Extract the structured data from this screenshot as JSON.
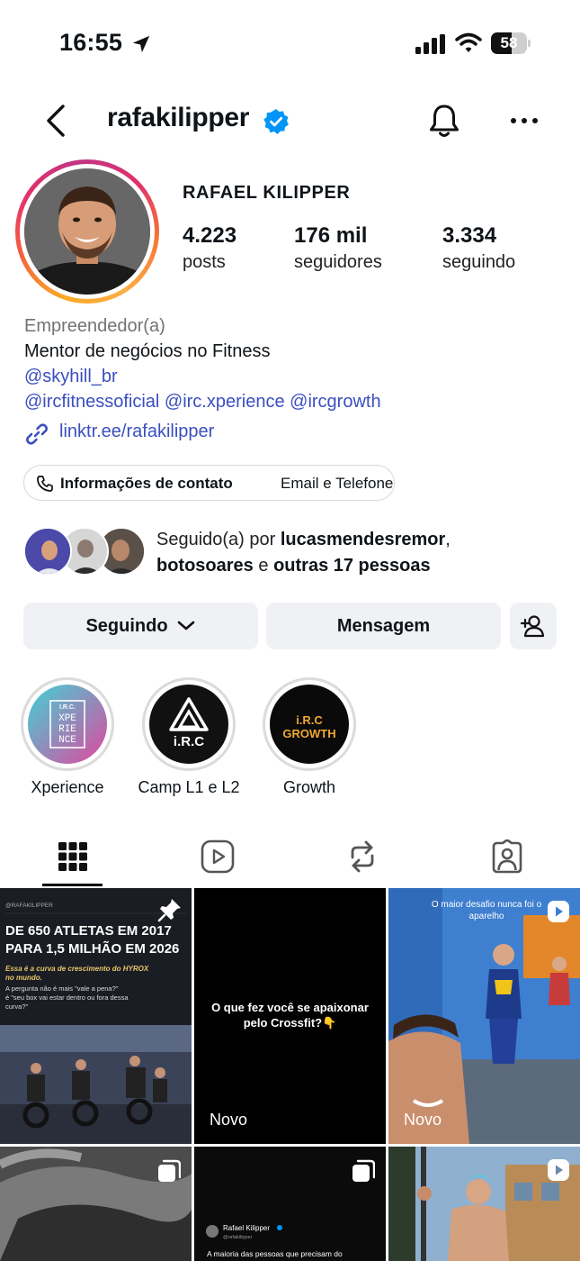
{
  "status_bar": {
    "time": "16:55",
    "battery": "58",
    "battery_level": 0.58
  },
  "header": {
    "username": "rafakilipper"
  },
  "profile": {
    "full_name": "RAFAEL KILIPPER",
    "stats": [
      {
        "value": "4.223",
        "label": "posts"
      },
      {
        "value": "176 mil",
        "label": "seguidores"
      },
      {
        "value": "3.334",
        "label": "seguindo"
      }
    ],
    "category": "Empreendedor(a)",
    "bio_line": "Mentor de negócios no Fitness",
    "mention_1": "@skyhill_br",
    "mentions_line": "@ircfitnessoficial @irc.xperience @ircgrowth",
    "link": "linktr.ee/rafakilipper",
    "contact_label": "Informações de contato",
    "contact_detail": "Email e Telefone"
  },
  "followed_by": {
    "prefix": "Seguido(a) por ",
    "user_1": "lucasmendesremor",
    "comma": ",",
    "user_2": "botosoares",
    "middle": " e ",
    "others": "outras 17 pessoas"
  },
  "actions": {
    "following": "Seguindo",
    "message": "Mensagem"
  },
  "highlights": [
    {
      "label": "Xperience",
      "logo_top": "I.R.C.",
      "logo_lines": [
        "XPE",
        "RIE",
        "NCE"
      ]
    },
    {
      "label": "Camp L1 e L2",
      "logo_text": "i.R.C"
    },
    {
      "label": "Growth",
      "logo_top": "i.R.C",
      "logo_bottom": "GROWTH"
    }
  ],
  "posts": {
    "p1": {
      "handle": "@RAFAKILIPPER",
      "headline": "DE 650 ATLETAS EM 2017 PARA 1,5 MILHÃO EM 2026",
      "sub1": "Essa é a curva de crescimento do HYROX no mundo.",
      "sub2": "A pergunta não é mais \"vale a pena?\" é \"seu box vai estar dentro ou fora dessa curva?\""
    },
    "p2": {
      "text": "O que fez você se apaixonar pelo Crossfit?👇",
      "badge": "Novo"
    },
    "p3": {
      "caption": "O maior desafio nunca foi o aparelho",
      "badge": "Novo"
    },
    "p5": {
      "name": "Rafael Kilipper",
      "handle": "@rafakilipper",
      "text": "A maioria das pessoas que precisam do"
    }
  },
  "colors": {
    "link": "#3a4fbf",
    "verified": "#0095f6",
    "button_bg": "#eff1f4"
  }
}
